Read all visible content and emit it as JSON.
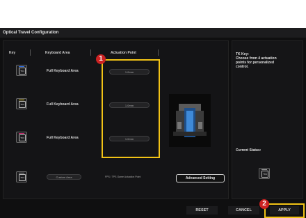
{
  "window": {
    "title": "Optical Travel Configuration"
  },
  "headers": {
    "key": "Key",
    "keyboard_area": "Keyboard Area",
    "actuation_point": "Actuation Point"
  },
  "rows": [
    {
      "icon_label": "TK1",
      "area": "Full Keyboard Area",
      "value": "1.0mm",
      "color": "#2d6de0"
    },
    {
      "icon_label": "TK2",
      "area": "Full Keyboard Area",
      "value": "1.0mm",
      "color": "#e0c92d"
    },
    {
      "icon_label": "TK3",
      "area": "Full Keyboard Area",
      "value": "1.0mm",
      "color": "#e02d7a"
    }
  ],
  "custom_row": {
    "icon_label": "TK4",
    "area": "Custom Area",
    "info": "FPS / TPS Game Actuation Point",
    "button": "Advanced Setting"
  },
  "right_panel": {
    "line1": "TK Key:",
    "line2": "Choose from 4 actuation",
    "line3": "points for personalized",
    "line4": "control.",
    "status_label": "Current Status:",
    "status_icon_label": "TK4"
  },
  "footer": {
    "reset": "RESET",
    "cancel": "CANCEL",
    "apply": "APPLY"
  },
  "callouts": {
    "one": "1",
    "two": "2"
  },
  "colors": {
    "highlight": "#f2c316",
    "badge": "#cc2222"
  }
}
